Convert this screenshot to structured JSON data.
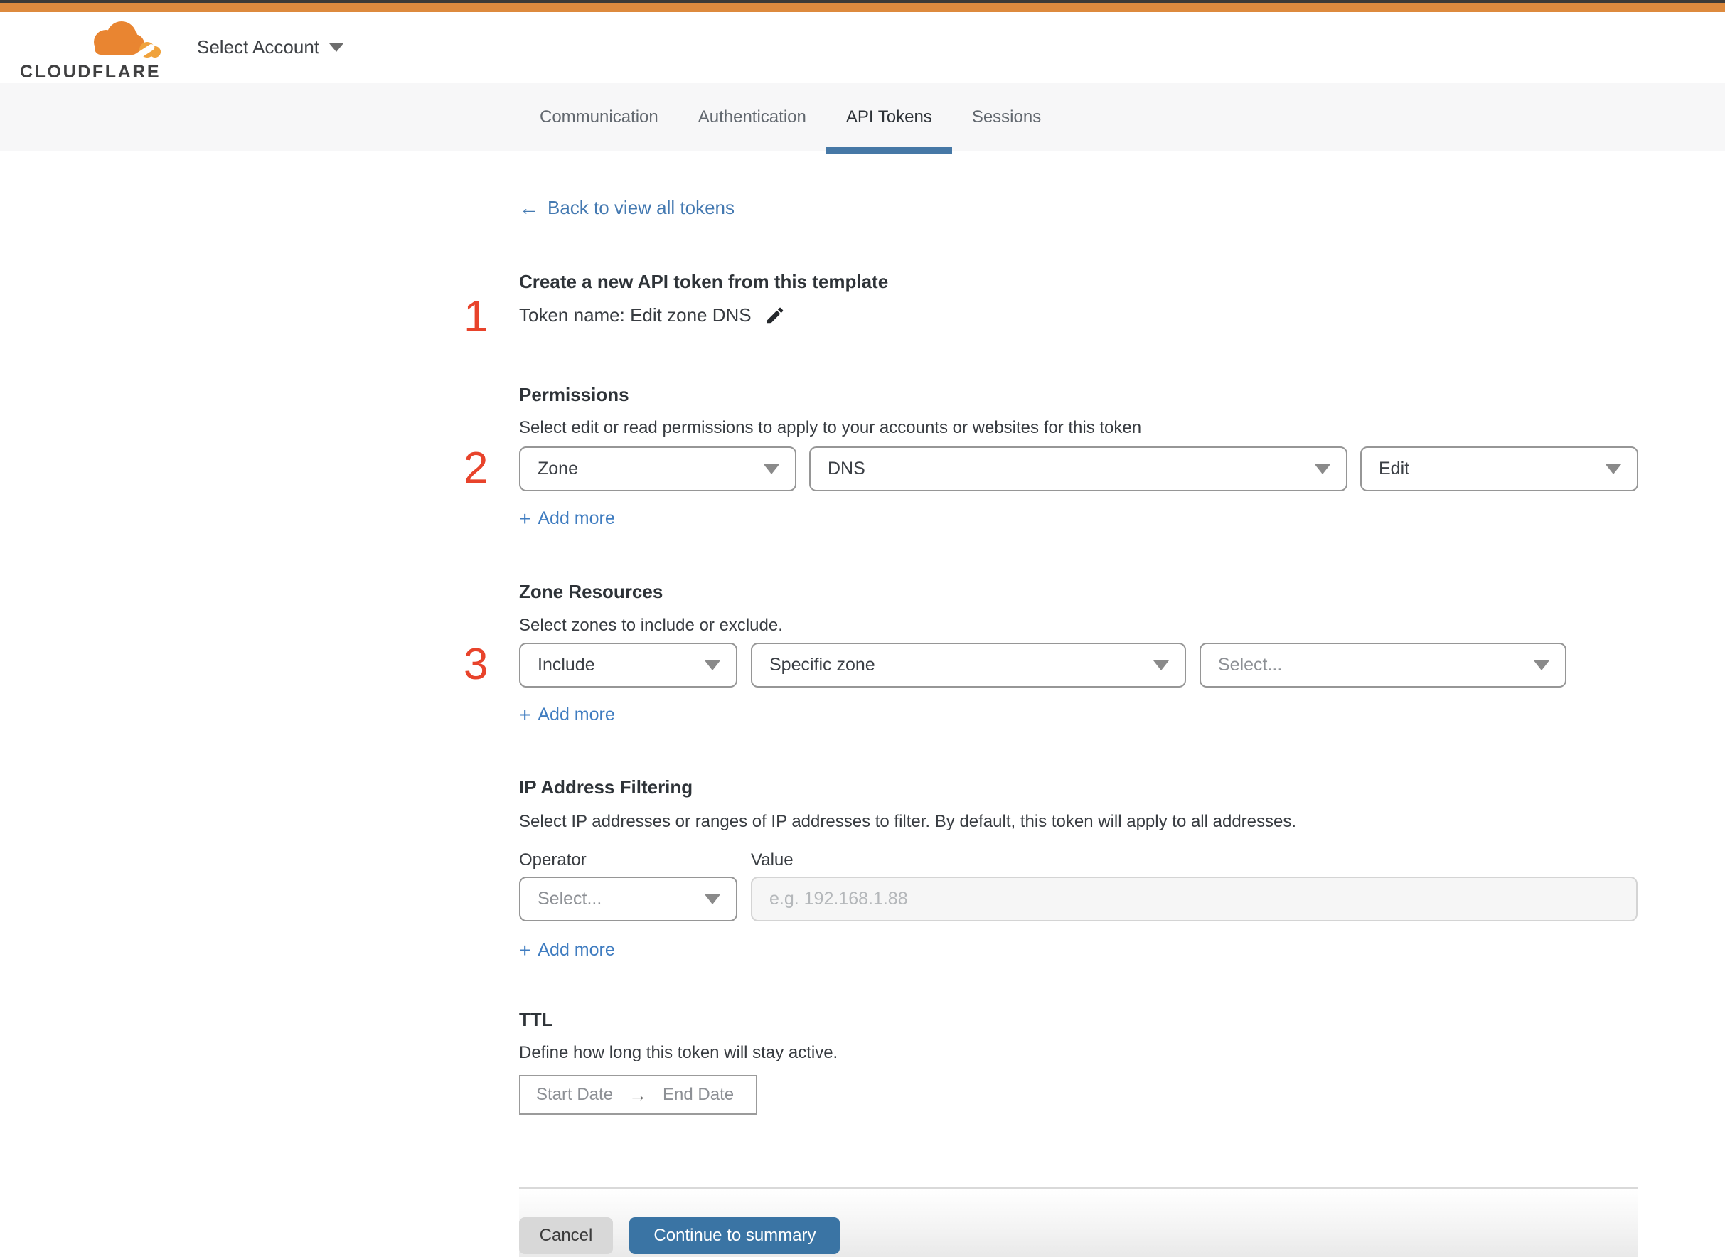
{
  "brand": {
    "wordmark": "CLOUDFLARE"
  },
  "header": {
    "account_selector": "Select Account"
  },
  "tabs": [
    {
      "label": "Communication",
      "active": false
    },
    {
      "label": "Authentication",
      "active": false
    },
    {
      "label": "API Tokens",
      "active": true
    },
    {
      "label": "Sessions",
      "active": false
    }
  ],
  "back": {
    "label": "Back to view all tokens"
  },
  "steps": [
    "1",
    "2",
    "3"
  ],
  "form": {
    "title": "Create a new API token from this template",
    "token_name_label": "Token name: Edit zone DNS",
    "permissions": {
      "heading": "Permissions",
      "description": "Select edit or read permissions to apply to your accounts or websites for this token",
      "selects": [
        {
          "value": "Zone"
        },
        {
          "value": "DNS"
        },
        {
          "value": "Edit"
        }
      ],
      "add_more": "Add more"
    },
    "zone_resources": {
      "heading": "Zone Resources",
      "description": "Select zones to include or exclude.",
      "selects": [
        {
          "value": "Include"
        },
        {
          "value": "Specific zone"
        },
        {
          "value": "Select...",
          "muted": true
        }
      ],
      "add_more": "Add more"
    },
    "ip_filtering": {
      "heading": "IP Address Filtering",
      "description": "Select IP addresses or ranges of IP addresses to filter. By default, this token will apply to all addresses.",
      "operator_label": "Operator",
      "value_label": "Value",
      "operator_value": "Select...",
      "value_placeholder": "e.g. 192.168.1.88",
      "add_more": "Add more"
    },
    "ttl": {
      "heading": "TTL",
      "description": "Define how long this token will stay active.",
      "start_label": "Start Date",
      "end_label": "End Date"
    }
  },
  "footer": {
    "cancel_label": "Cancel",
    "continue_label": "Continue to summary"
  },
  "icons": {
    "back_arrow": "←",
    "date_arrow": "→",
    "plus": "+"
  },
  "colors": {
    "top_bar_orange": "#dd8a3e",
    "tab_underline_blue": "#4678a6",
    "link_blue": "#4479b1",
    "add_more_blue": "#3f7cc0",
    "step_marker_red": "#e8432b",
    "continue_button_blue": "#3a74a4",
    "cancel_button_gray": "#d8d8d8"
  }
}
